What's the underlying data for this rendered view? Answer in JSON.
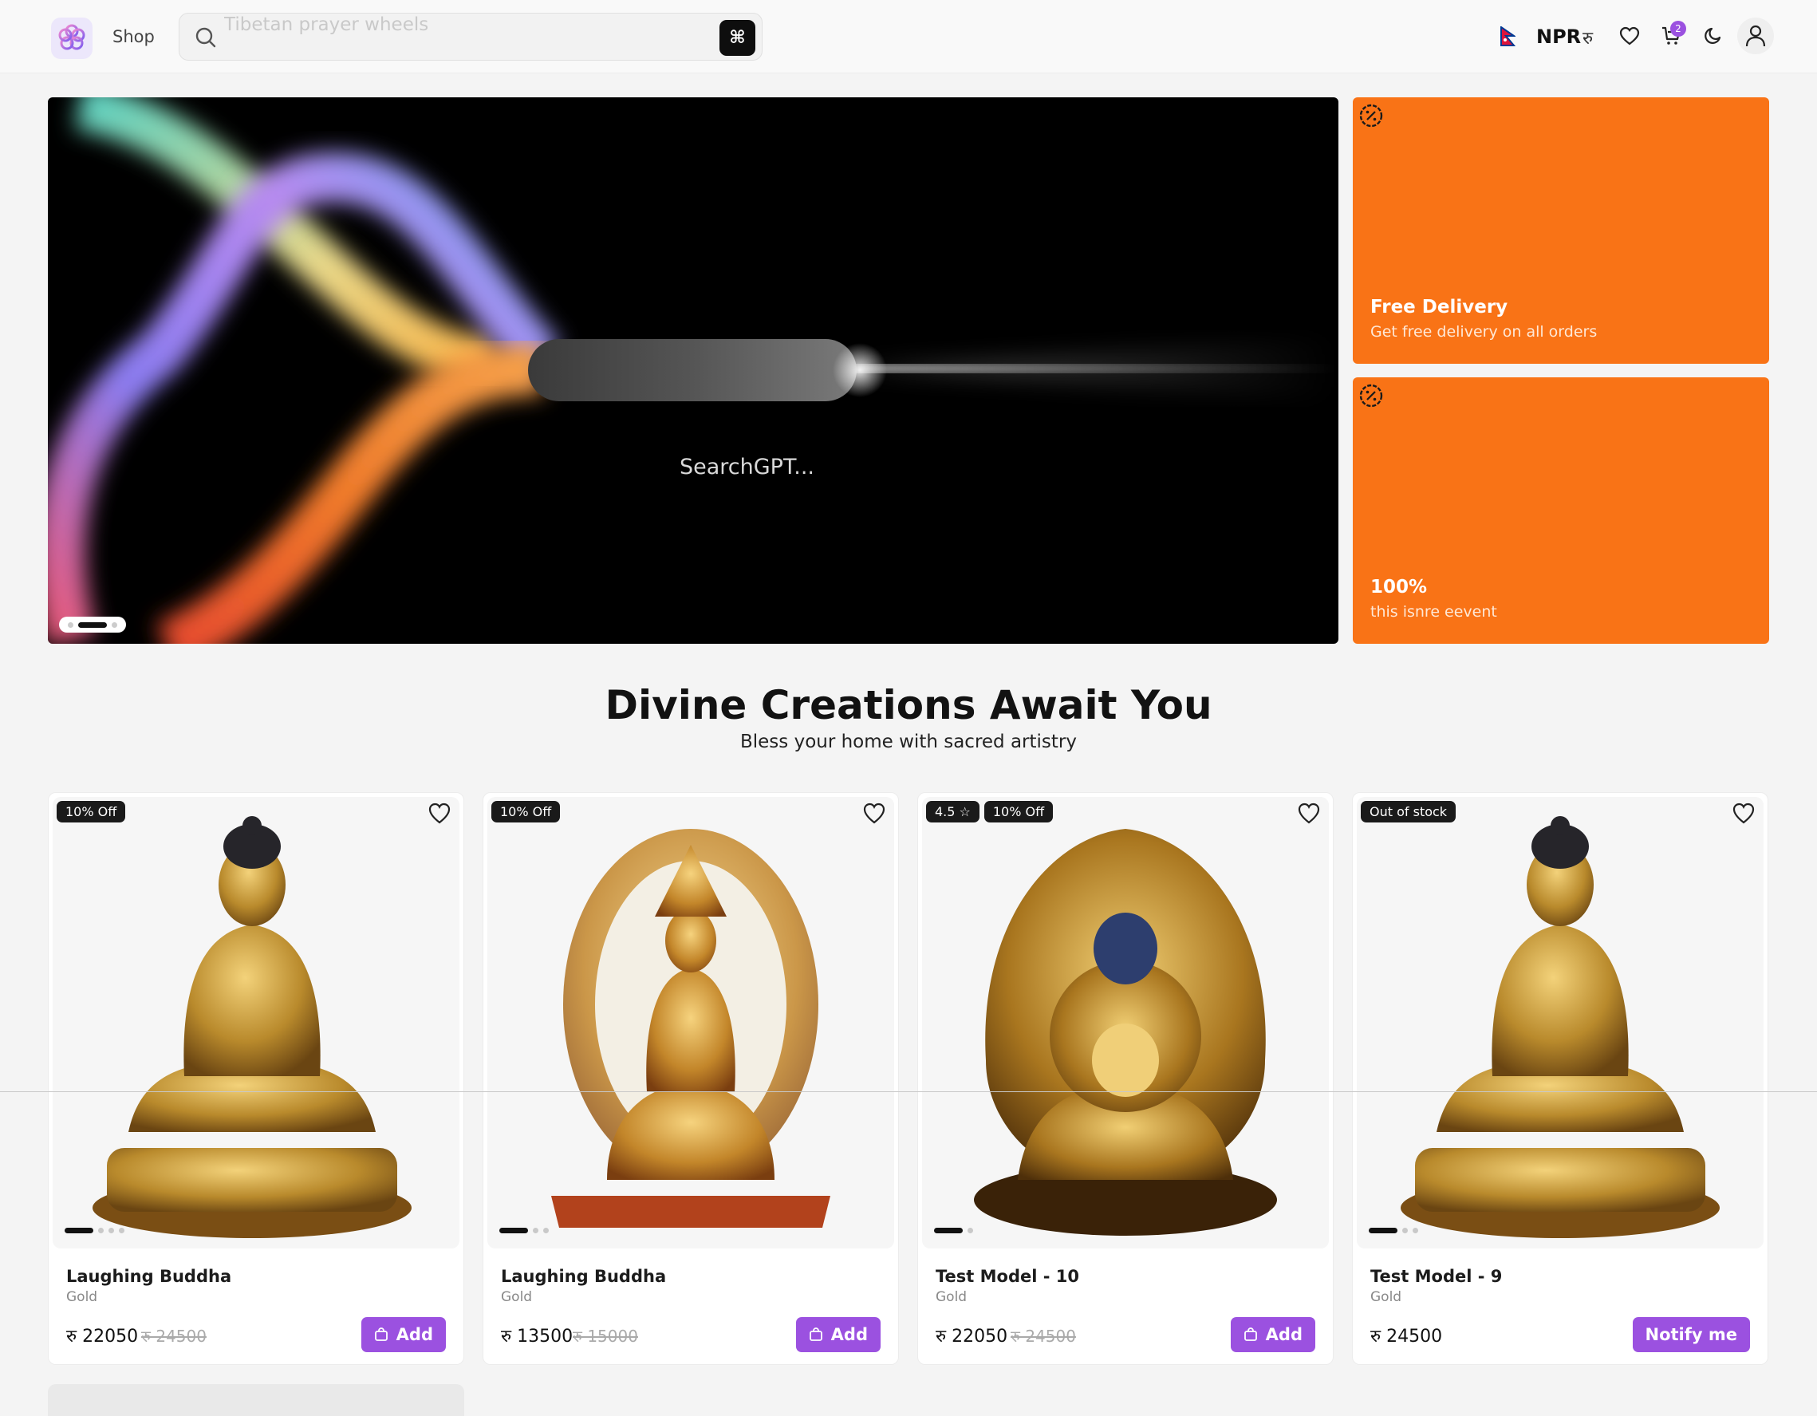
{
  "header": {
    "shop_label": "Shop",
    "search_placeholder": "Tibetan prayer wheels",
    "shortcut_key": "⌘",
    "currency_code": "NPR",
    "currency_symbol": "रु",
    "cart_count": "2",
    "icons": [
      "search-icon",
      "nepal-flag-icon",
      "heart-icon",
      "cart-icon",
      "moon-icon",
      "user-icon"
    ]
  },
  "hero": {
    "pill_text": "SearchGPT...",
    "slide_count": 3,
    "active_slide": 1
  },
  "promos": [
    {
      "title": "Free Delivery",
      "subtitle": "Get free delivery on all orders",
      "icon": "discount-badge-icon",
      "color": "#f97316"
    },
    {
      "title": "100%",
      "subtitle": "this isnre eevent",
      "icon": "discount-badge-icon",
      "color": "#f97316"
    }
  ],
  "section": {
    "title": "Divine Creations Await You",
    "subtitle": "Bless your home with sacred artistry"
  },
  "products": [
    {
      "tags": [
        "10% Off"
      ],
      "name": "Laughing Buddha",
      "variant": "Gold",
      "price": "रु 22050",
      "old_price": "रु 24500",
      "action": "Add",
      "image_slides": 4
    },
    {
      "tags": [
        "10% Off"
      ],
      "name": "Laughing Buddha",
      "variant": "Gold",
      "price": "रु 13500",
      "old_price": "रु 15000",
      "action": "Add",
      "image_slides": 3
    },
    {
      "tags": [
        "4.5 ☆",
        "10% Off"
      ],
      "name": "Test Model - 10",
      "variant": "Gold",
      "price": "रु 22050",
      "old_price": "रु 24500",
      "action": "Add",
      "image_slides": 2
    },
    {
      "tags": [
        "Out of stock"
      ],
      "name": "Test Model - 9",
      "variant": "Gold",
      "price": "रु 24500",
      "old_price": "",
      "action": "Notify me",
      "image_slides": 3
    }
  ],
  "colors": {
    "accent": "#9b51e0",
    "promo": "#f97316",
    "tag_bg": "#1a1a1a"
  }
}
